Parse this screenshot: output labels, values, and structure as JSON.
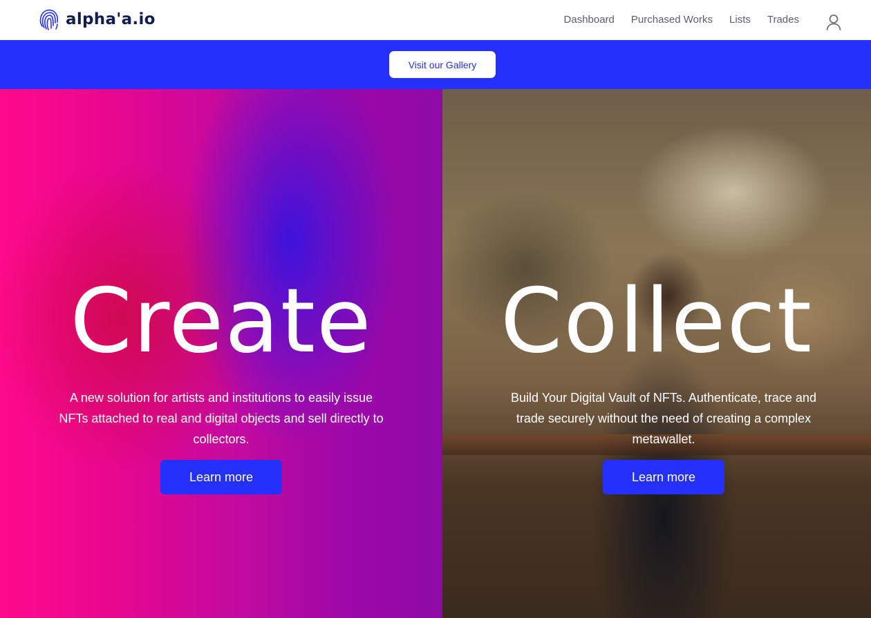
{
  "header": {
    "brand": "alpha'a.io",
    "nav": [
      "Dashboard",
      "Purchased Works",
      "Lists",
      "Trades"
    ],
    "user_icon": "user-icon",
    "logo_icon": "fingerprint-icon"
  },
  "banner": {
    "button_label": "Visit our Gallery",
    "color": "#2531fb"
  },
  "panels": {
    "create": {
      "title": "Create",
      "description": "A new solution for artists and institutions to easily issue NFTs attached to real and digital objects and sell directly to collectors.",
      "button_label": "Learn more"
    },
    "collect": {
      "title": "Collect",
      "description": "Build Your Digital Vault of NFTs. Authenticate, trace and trade securely without the need of creating a complex metawallet.",
      "button_label": "Learn more"
    }
  }
}
